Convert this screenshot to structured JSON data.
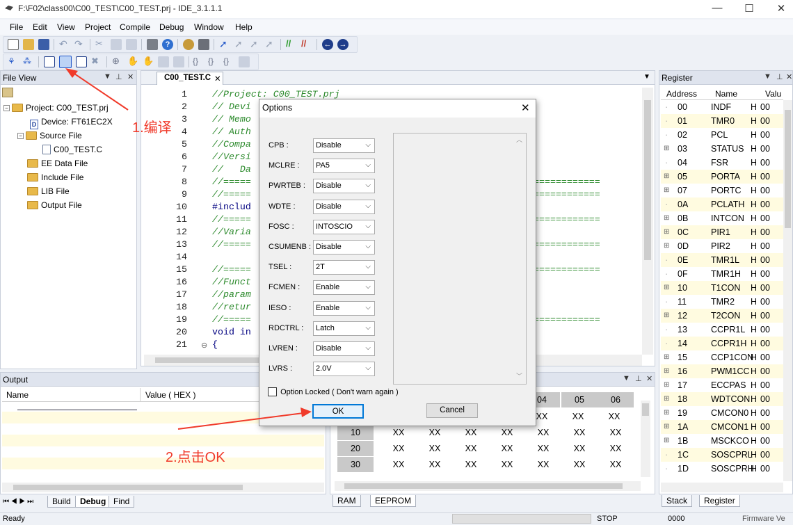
{
  "window": {
    "title": "F:\\F02\\class00\\C00_TEST\\C00_TEST.prj - IDE_3.1.1.1"
  },
  "menu": [
    "File",
    "Edit",
    "View",
    "Project",
    "Compile",
    "Debug",
    "Window",
    "Help"
  ],
  "file_view": {
    "title": "File View",
    "tree": {
      "project": "Project:  C00_TEST.prj",
      "device": "Device:  FT61EC2X",
      "source_folder": "Source File",
      "source_file": "C00_TEST.C",
      "ee_folder": "EE Data File",
      "include_folder": "Include File",
      "lib_folder": "LIB File",
      "output_folder": "Output File"
    }
  },
  "editor": {
    "tab": "C00_TEST.C",
    "lines": [
      {
        "n": "1",
        "text": "//Project: C00_TEST.prj",
        "cls": "cmt"
      },
      {
        "n": "2",
        "text": "// Devi",
        "cls": "cmt"
      },
      {
        "n": "3",
        "text": "// Memo",
        "cls": "cmt"
      },
      {
        "n": "4",
        "text": "// Auth",
        "cls": "cmt"
      },
      {
        "n": "5",
        "text": "//Compa",
        "cls": "cmt"
      },
      {
        "n": "6",
        "text": "//Versi",
        "cls": "cmt"
      },
      {
        "n": "7",
        "text": "//   Da",
        "cls": "cmt"
      },
      {
        "n": "8",
        "text": "//=====",
        "cls": "cmt"
      },
      {
        "n": "9",
        "text": "//=====",
        "cls": "cmt"
      },
      {
        "n": "10",
        "text": "#includ",
        "cls": "kw"
      },
      {
        "n": "11",
        "text": "//=====",
        "cls": "cmt"
      },
      {
        "n": "12",
        "text": "//Varia",
        "cls": "cmt"
      },
      {
        "n": "13",
        "text": "//=====",
        "cls": "cmt"
      },
      {
        "n": "14",
        "text": "",
        "cls": "cmt"
      },
      {
        "n": "15",
        "text": "//=====",
        "cls": "cmt"
      },
      {
        "n": "16",
        "text": "//Funct",
        "cls": "cmt"
      },
      {
        "n": "17",
        "text": "//param",
        "cls": "cmt"
      },
      {
        "n": "18",
        "text": "//retur",
        "cls": "cmt"
      },
      {
        "n": "19",
        "text": "//=====",
        "cls": "cmt"
      },
      {
        "n": "20",
        "text": "void in",
        "cls": "kw"
      },
      {
        "n": "21",
        "text": "{",
        "cls": "kw"
      }
    ],
    "right_eq": [
      "============",
      "============",
      "============",
      "============",
      "============",
      "============",
      "============"
    ]
  },
  "annotations": {
    "step1": "1.编译",
    "step2": "2.点击OK"
  },
  "dialog": {
    "title": "Options",
    "options": [
      {
        "label": "CPB :",
        "value": "Disable"
      },
      {
        "label": "MCLRE :",
        "value": "PA5"
      },
      {
        "label": "PWRTEB :",
        "value": "Disable"
      },
      {
        "label": "WDTE :",
        "value": "Disable"
      },
      {
        "label": "FOSC :",
        "value": "INTOSCIO"
      },
      {
        "label": "CSUMENB :",
        "value": "Disable"
      },
      {
        "label": "TSEL :",
        "value": "2T"
      },
      {
        "label": "FCMEN :",
        "value": "Enable"
      },
      {
        "label": "IESO :",
        "value": "Enable"
      },
      {
        "label": "RDCTRL :",
        "value": "Latch"
      },
      {
        "label": "LVREN :",
        "value": "Disable"
      },
      {
        "label": "LVRS :",
        "value": "2.0V"
      }
    ],
    "checkbox_label": "Option Locked ( Don't warn again )",
    "ok": "OK",
    "cancel": "Cancel"
  },
  "register": {
    "title": "Register",
    "headers": [
      "Address",
      "Name",
      "Valu"
    ],
    "rows": [
      {
        "addr": "00",
        "name": "INDF",
        "h": "H",
        "val": "00",
        "exp": false,
        "hl": false
      },
      {
        "addr": "01",
        "name": "TMR0",
        "h": "H",
        "val": "00",
        "exp": false,
        "hl": true
      },
      {
        "addr": "02",
        "name": "PCL",
        "h": "H",
        "val": "00",
        "exp": false,
        "hl": false
      },
      {
        "addr": "03",
        "name": "STATUS",
        "h": "H",
        "val": "00",
        "exp": true,
        "hl": false
      },
      {
        "addr": "04",
        "name": "FSR",
        "h": "H",
        "val": "00",
        "exp": false,
        "hl": false
      },
      {
        "addr": "05",
        "name": "PORTA",
        "h": "H",
        "val": "00",
        "exp": true,
        "hl": true
      },
      {
        "addr": "07",
        "name": "PORTC",
        "h": "H",
        "val": "00",
        "exp": true,
        "hl": false
      },
      {
        "addr": "0A",
        "name": "PCLATH",
        "h": "H",
        "val": "00",
        "exp": false,
        "hl": true
      },
      {
        "addr": "0B",
        "name": "INTCON",
        "h": "H",
        "val": "00",
        "exp": true,
        "hl": false
      },
      {
        "addr": "0C",
        "name": "PIR1",
        "h": "H",
        "val": "00",
        "exp": true,
        "hl": true
      },
      {
        "addr": "0D",
        "name": "PIR2",
        "h": "H",
        "val": "00",
        "exp": true,
        "hl": false
      },
      {
        "addr": "0E",
        "name": "TMR1L",
        "h": "H",
        "val": "00",
        "exp": false,
        "hl": true
      },
      {
        "addr": "0F",
        "name": "TMR1H",
        "h": "H",
        "val": "00",
        "exp": false,
        "hl": false
      },
      {
        "addr": "10",
        "name": "T1CON",
        "h": "H",
        "val": "00",
        "exp": true,
        "hl": true
      },
      {
        "addr": "11",
        "name": "TMR2",
        "h": "H",
        "val": "00",
        "exp": false,
        "hl": false
      },
      {
        "addr": "12",
        "name": "T2CON",
        "h": "H",
        "val": "00",
        "exp": true,
        "hl": true
      },
      {
        "addr": "13",
        "name": "CCPR1L",
        "h": "H",
        "val": "00",
        "exp": false,
        "hl": false
      },
      {
        "addr": "14",
        "name": "CCPR1H",
        "h": "H",
        "val": "00",
        "exp": false,
        "hl": true
      },
      {
        "addr": "15",
        "name": "CCP1CON",
        "h": "H",
        "val": "00",
        "exp": true,
        "hl": false
      },
      {
        "addr": "16",
        "name": "PWM1CC",
        "h": "H",
        "val": "00",
        "exp": true,
        "hl": true
      },
      {
        "addr": "17",
        "name": "ECCPAS",
        "h": "H",
        "val": "00",
        "exp": true,
        "hl": false
      },
      {
        "addr": "18",
        "name": "WDTCON",
        "h": "H",
        "val": "00",
        "exp": true,
        "hl": true
      },
      {
        "addr": "19",
        "name": "CMCON0",
        "h": "H",
        "val": "00",
        "exp": true,
        "hl": false
      },
      {
        "addr": "1A",
        "name": "CMCON1",
        "h": "H",
        "val": "00",
        "exp": true,
        "hl": true
      },
      {
        "addr": "1B",
        "name": "MSCKCO",
        "h": "H",
        "val": "00",
        "exp": true,
        "hl": false
      },
      {
        "addr": "1C",
        "name": "SOSCPRL",
        "h": "H",
        "val": "00",
        "exp": false,
        "hl": true
      },
      {
        "addr": "1D",
        "name": "SOSCPRH",
        "h": "H",
        "val": "00",
        "exp": false,
        "hl": false
      }
    ],
    "tabs": [
      "Stack",
      "Register"
    ]
  },
  "output": {
    "title": "Output",
    "headers": [
      "Name",
      "Value ( HEX )"
    ],
    "tabs": [
      "Build",
      "Debug",
      "Find"
    ]
  },
  "memory": {
    "col_headers": [
      "04",
      "05",
      "06"
    ],
    "rows": [
      {
        "label": "",
        "cells": [
          "XX",
          "XX",
          "XX"
        ],
        "full": false
      },
      {
        "label": "10",
        "cells": [
          "XX",
          "XX",
          "XX",
          "XX",
          "XX",
          "XX",
          "XX"
        ],
        "full": true
      },
      {
        "label": "20",
        "cells": [
          "XX",
          "XX",
          "XX",
          "XX",
          "XX",
          "XX",
          "XX"
        ],
        "full": true
      },
      {
        "label": "30",
        "cells": [
          "XX",
          "XX",
          "XX",
          "XX",
          "XX",
          "XX",
          "XX"
        ],
        "full": true
      }
    ],
    "tabs": [
      "RAM",
      "EEPROM"
    ]
  },
  "status": {
    "ready": "Ready",
    "state": "STOP",
    "pc": "0000",
    "firmware": "Firmware Ve"
  },
  "colors": {
    "annotation_red": "#f03a2a",
    "highlight_row": "#fffbe0"
  }
}
